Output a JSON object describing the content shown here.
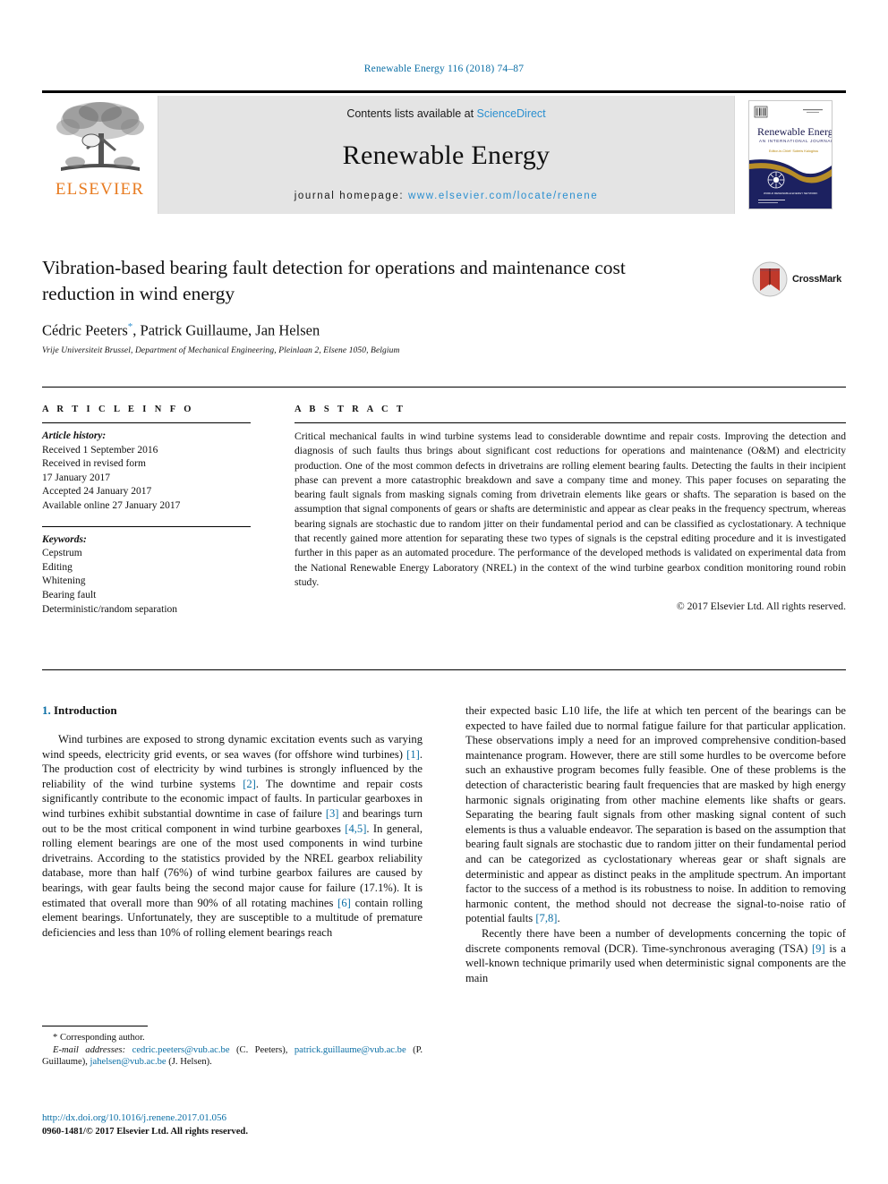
{
  "running_head": "Renewable Energy 116 (2018) 74–87",
  "masthead": {
    "publisher_name": "ELSEVIER",
    "contents_prefix": "Contents lists available at ",
    "contents_link": "ScienceDirect",
    "journal_name": "Renewable Energy",
    "homepage_prefix": "journal homepage: ",
    "homepage_url": "www.elsevier.com/locate/renene",
    "cover": {
      "title": "Renewable Energy",
      "subtitle": "AN INTERNATIONAL JOURNAL",
      "editor_line": "Editor-in-Chief: Soteris Kalogirou"
    }
  },
  "article": {
    "title": "Vibration-based bearing fault detection for operations and maintenance cost reduction in wind energy",
    "authors": "Cédric Peeters",
    "authors_rest": ", Patrick Guillaume, Jan Helsen",
    "corresponding_marker": "*",
    "affiliation": "Vrije Universiteit Brussel, Department of Mechanical Engineering, Pleinlaan 2, Elsene 1050, Belgium",
    "crossmark_label": "CrossMark"
  },
  "article_info": {
    "heading": "A R T I C L E   I N F O",
    "history_label": "Article history:",
    "history": [
      "Received 1 September 2016",
      "Received in revised form",
      "17 January 2017",
      "Accepted 24 January 2017",
      "Available online 27 January 2017"
    ],
    "keywords_label": "Keywords:",
    "keywords": [
      "Cepstrum",
      "Editing",
      "Whitening",
      "Bearing fault",
      "Deterministic/random separation"
    ]
  },
  "abstract": {
    "heading": "A B S T R A C T",
    "text": "Critical mechanical faults in wind turbine systems lead to considerable downtime and repair costs. Improving the detection and diagnosis of such faults thus brings about significant cost reductions for operations and maintenance (O&M) and electricity production. One of the most common defects in drivetrains are rolling element bearing faults. Detecting the faults in their incipient phase can prevent a more catastrophic breakdown and save a company time and money. This paper focuses on separating the bearing fault signals from masking signals coming from drivetrain elements like gears or shafts. The separation is based on the assumption that signal components of gears or shafts are deterministic and appear as clear peaks in the frequency spectrum, whereas bearing signals are stochastic due to random jitter on their fundamental period and can be classified as cyclostationary. A technique that recently gained more attention for separating these two types of signals is the cepstral editing procedure and it is investigated further in this paper as an automated procedure. The performance of the developed methods is validated on experimental data from the National Renewable Energy Laboratory (NREL) in the context of the wind turbine gearbox condition monitoring round robin study.",
    "copyright": "© 2017 Elsevier Ltd. All rights reserved."
  },
  "section": {
    "number": "1.",
    "title": "Introduction"
  },
  "body": {
    "left_paragraph_1_part1": "Wind turbines are exposed to strong dynamic excitation events such as varying wind speeds, electricity grid events, or sea waves (for offshore wind turbines) ",
    "ref1": "[1]",
    "left_paragraph_1_part2": ". The production cost of electricity by wind turbines is strongly influenced by the reliability of the wind turbine systems ",
    "ref2": "[2]",
    "left_paragraph_1_part3": ". The downtime and repair costs significantly contribute to the economic impact of faults. In particular gearboxes in wind turbines exhibit substantial downtime in case of failure ",
    "ref3": "[3]",
    "left_paragraph_1_part4": " and bearings turn out to be the most critical component in wind turbine gearboxes ",
    "ref45": "[4,5]",
    "left_paragraph_1_part5": ". In general, rolling element bearings are one of the most used components in wind turbine drivetrains. According to the statistics provided by the NREL gearbox reliability database, more than half (76%) of wind turbine gearbox failures are caused by bearings, with gear faults being the second major cause for failure (17.1%). It is estimated that overall more than 90% of all rotating machines ",
    "ref6": "[6]",
    "left_paragraph_1_part6": " contain rolling element bearings. Unfortunately, they are susceptible to a multitude of premature deficiencies and less than 10% of rolling element bearings reach",
    "right_paragraph_1_part1": "their expected basic L10 life, the life at which ten percent of the bearings can be expected to have failed due to normal fatigue failure for that particular application. These observations imply a need for an improved comprehensive condition-based maintenance program. However, there are still some hurdles to be overcome before such an exhaustive program becomes fully feasible. One of these problems is the detection of characteristic bearing fault frequencies that are masked by high energy harmonic signals originating from other machine elements like shafts or gears. Separating the bearing fault signals from other masking signal content of such elements is thus a valuable endeavor. The separation is based on the assumption that bearing fault signals are stochastic due to random jitter on their fundamental period and can be categorized as cyclostationary whereas gear or shaft signals are deterministic and appear as distinct peaks in the amplitude spectrum. An important factor to the success of a method is its robustness to noise. In addition to removing harmonic content, the method should not decrease the signal-to-noise ratio of potential faults ",
    "ref78": "[7,8]",
    "right_paragraph_1_part2": ".",
    "right_paragraph_2_part1": "Recently there have been a number of developments concerning the topic of discrete components removal (DCR). Time-synchronous averaging (TSA) ",
    "ref9": "[9]",
    "right_paragraph_2_part2": " is a well-known technique primarily used when deterministic signal components are the main"
  },
  "footnotes": {
    "corresponding": "* Corresponding author.",
    "email_label": "E-mail addresses:",
    "email_1": "cedric.peeters@vub.ac.be",
    "email_1_owner": " (C. Peeters), ",
    "email_2": "patrick.guillaume@vub.ac.be",
    "email_2_owner": " (P. Guillaume), ",
    "email_3": "jahelsen@vub.ac.be",
    "email_3_owner": " (J. Helsen)."
  },
  "doi": {
    "link": "http://dx.doi.org/10.1016/j.renene.2017.01.056",
    "issn": "0960-1481/© 2017 Elsevier Ltd. All rights reserved."
  },
  "colors": {
    "link_blue": "#0a6ea5",
    "science_direct_blue": "#2a8fd0",
    "elsevier_orange": "#E87B20",
    "band_gray": "#e4e4e4"
  }
}
